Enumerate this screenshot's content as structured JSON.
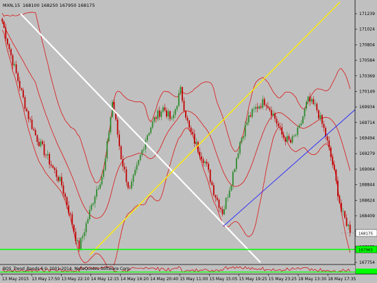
{
  "header": {
    "symbol": "MXN,15",
    "ohlc": "168100 168250 167950 168175"
  },
  "indicator": {
    "label": "BOS_Trend_Bands 6",
    "copyright": "© 2001-2014, MetaQuotes Software Corp."
  },
  "colors": {
    "background": "#c0c0c0",
    "candle_up": "#2e8b2e",
    "candle_down": "#c00000",
    "bollinger": "#dd1111",
    "trend_white": "#ffffff",
    "trend_yellow": "#ffee00",
    "trend_blue": "#2222ff",
    "level_green": "#00ff00",
    "bid_tag": "#ffffff"
  },
  "price_axis": {
    "labels": [
      "171239",
      "171024",
      "170804",
      "170584",
      "170369",
      "170149",
      "169934",
      "169714",
      "169494",
      "169279",
      "169064",
      "168844",
      "168624",
      "168409",
      "168175",
      "167975",
      "167754"
    ],
    "current_price_tag": "168175",
    "green_level_tag": "167965"
  },
  "time_axis": {
    "labels": [
      "13 May 2015",
      "13 May 17:50",
      "13 May 22:10",
      "14 May 12:15",
      "14 May 16:20",
      "14 May 20:40",
      "15 May 11:00",
      "15 May 15:05",
      "15 May 19:25",
      "15 May 23:25",
      "18 May 13:30",
      "18 May 17:35"
    ]
  },
  "chart_data": {
    "type": "candlestick",
    "symbol": "MXN",
    "timeframe": "M15",
    "y_range": [
      167680,
      171320
    ],
    "current_price": 168175,
    "horizontal_level": 167965,
    "x_categories": [
      "13 May 2015",
      "13 May 17:50",
      "13 May 22:10",
      "14 May 12:15",
      "14 May 16:20",
      "14 May 20:40",
      "15 May 11:00",
      "15 May 15:05",
      "15 May 19:25",
      "15 May 23:25",
      "18 May 13:30",
      "18 May 17:35"
    ],
    "price_path": [
      171150,
      170680,
      170250,
      169820,
      169500,
      169280,
      169050,
      168820,
      168380,
      167900,
      168300,
      168720,
      169020,
      170020,
      169220,
      168720,
      169110,
      169520,
      169770,
      169920,
      169720,
      170170,
      169620,
      169350,
      169120,
      168700,
      168420,
      168880,
      169420,
      169770,
      169930,
      170020,
      169810,
      169520,
      169420,
      169610,
      170030,
      169920,
      169580,
      169080,
      168420,
      168175
    ]
  }
}
